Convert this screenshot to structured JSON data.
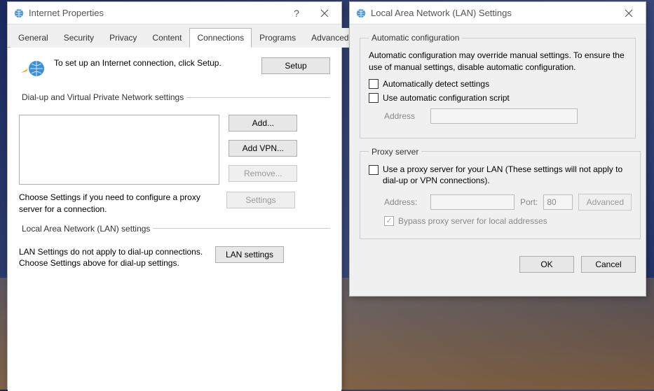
{
  "left": {
    "title": "Internet Properties",
    "tabs": [
      "General",
      "Security",
      "Privacy",
      "Content",
      "Connections",
      "Programs",
      "Advanced"
    ],
    "setup_text": "To set up an Internet connection, click Setup.",
    "setup_btn": "Setup",
    "dialup_legend": "Dial-up and Virtual Private Network settings",
    "add_btn": "Add...",
    "addvpn_btn": "Add VPN...",
    "remove_btn": "Remove...",
    "settings_btn": "Settings",
    "proxy_note": "Choose Settings if you need to configure a proxy server for a connection.",
    "lan_legend": "Local Area Network (LAN) settings",
    "lan_note": "LAN Settings do not apply to dial-up connections. Choose Settings above for dial-up settings.",
    "lan_btn": "LAN settings"
  },
  "right": {
    "title": "Local Area Network (LAN) Settings",
    "auto_legend": "Automatic configuration",
    "auto_desc": "Automatic configuration may override manual settings.  To ensure the use of manual settings, disable automatic configuration.",
    "auto_detect": "Automatically detect settings",
    "auto_script": "Use automatic configuration script",
    "address_label": "Address",
    "proxy_legend": "Proxy server",
    "proxy_use": "Use a proxy server for your LAN (These settings will not apply to dial-up or VPN connections).",
    "address2_label": "Address:",
    "port_label": "Port:",
    "port_value": "80",
    "advanced_btn": "Advanced",
    "bypass": "Bypass proxy server for local addresses",
    "ok_btn": "OK",
    "cancel_btn": "Cancel"
  }
}
